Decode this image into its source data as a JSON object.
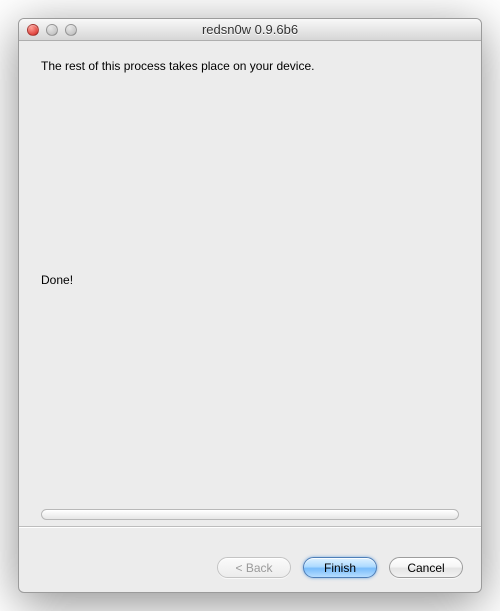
{
  "window": {
    "title": "redsn0w 0.9.6b6"
  },
  "main": {
    "instruction": "The rest of this process takes place on your device.",
    "status": "Done!"
  },
  "buttons": {
    "back": "< Back",
    "finish": "Finish",
    "cancel": "Cancel"
  }
}
